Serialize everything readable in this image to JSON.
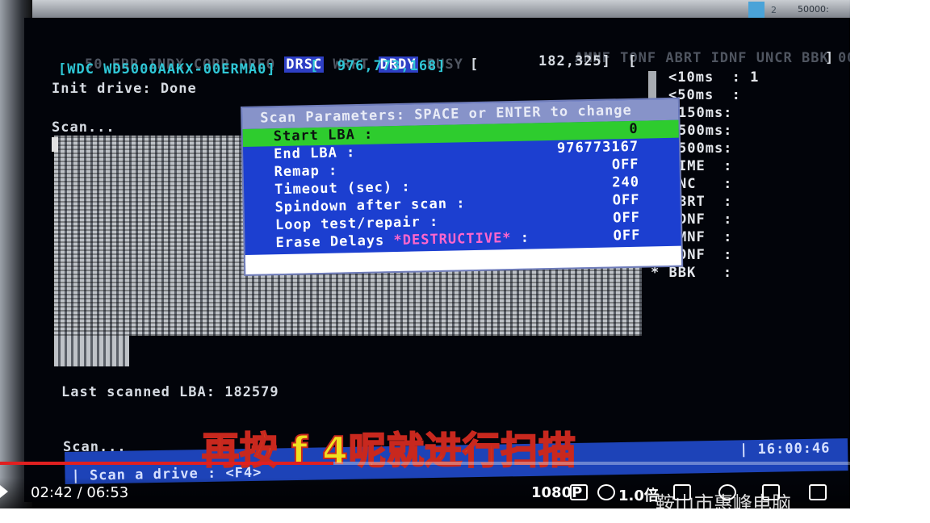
{
  "system_tray": {
    "icon": "window-icon",
    "label": "2",
    "disk_label": "50000:"
  },
  "hdd": {
    "status_flags_left": [
      "50",
      "ERR",
      "INDX",
      "CORR",
      "DREQ",
      "DRSC",
      "WRFT",
      "DRDY",
      "BUSY"
    ],
    "status_flags_right": [
      "AMNF",
      "TONF",
      "ABRT",
      "IDNF",
      "UNCR",
      "BBK",
      "00"
    ],
    "drive_model": "[WDC WD5000AAKX-00ERMA0]",
    "total_lba": "[  976,773,168]",
    "current_lba": "[",
    "scanned_count": "182,325]",
    "bracket_open": "[",
    "bracket_close": "]",
    "init_line": "Init drive: Done",
    "scan_line": "Scan...",
    "last_scanned": "Last scanned LBA: 182579",
    "scan_line_bottom": "Scan..."
  },
  "histogram": [
    "<10ms  : 1",
    "<50ms  :",
    "150ms:",
    "500ms:",
    "500ms:",
    "IME  :",
    "NC   :",
    "BRT  :",
    "DNF  :",
    "MNF  :",
    "ONF  :",
    "* BBK   :"
  ],
  "dialog": {
    "title": "Scan Parameters: SPACE or ENTER to change",
    "rows": [
      {
        "label": "Start LBA :",
        "value": "0"
      },
      {
        "label": "End LBA :",
        "value": "976773167"
      },
      {
        "label": "Remap :",
        "value": "OFF"
      },
      {
        "label": "Timeout (sec) :",
        "value": "240"
      },
      {
        "label": "Spindown after scan :",
        "value": "OFF"
      },
      {
        "label": "Loop test/repair :",
        "value": "OFF"
      },
      {
        "label_prefix": "Erase Delays ",
        "label_warn": "*DESTRUCTIVE*",
        "label_suffix": " :",
        "value": "OFF"
      }
    ]
  },
  "statusbar": {
    "hint": "| Scan a drive : <F4>",
    "clock": "| 16:00:46"
  },
  "caption": "再按 f 4呢就进行扫描",
  "player": {
    "time": "02:42 / 06:53",
    "quality": "1080P",
    "speed": "1.0倍",
    "progress": 0.392,
    "watermark": "鞍山市惠峰电脑"
  }
}
